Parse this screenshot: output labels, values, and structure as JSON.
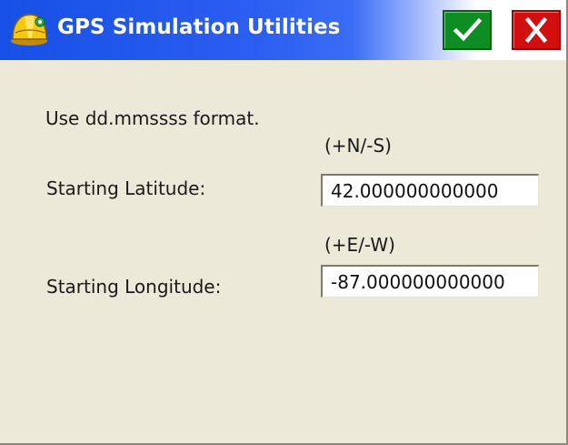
{
  "window": {
    "title": "GPS Simulation Utilities",
    "title_icon": "hard-hat-surveyor-icon",
    "ok_icon": "checkmark-icon",
    "close_icon": "close-icon",
    "colors": {
      "titlebar_start": "#1750e6",
      "titlebar_end": "#ffffff",
      "body": "#ece9d8",
      "ok": "#0e8d22",
      "close": "#d10f0f"
    }
  },
  "form": {
    "instruction": "Use dd.mmssss format.",
    "latitude": {
      "hint": "(+N/-S)",
      "label": "Starting Latitude:",
      "value": "42.000000000000"
    },
    "longitude": {
      "hint": "(+E/-W)",
      "label": "Starting Longitude:",
      "value": "-87.000000000000"
    }
  }
}
